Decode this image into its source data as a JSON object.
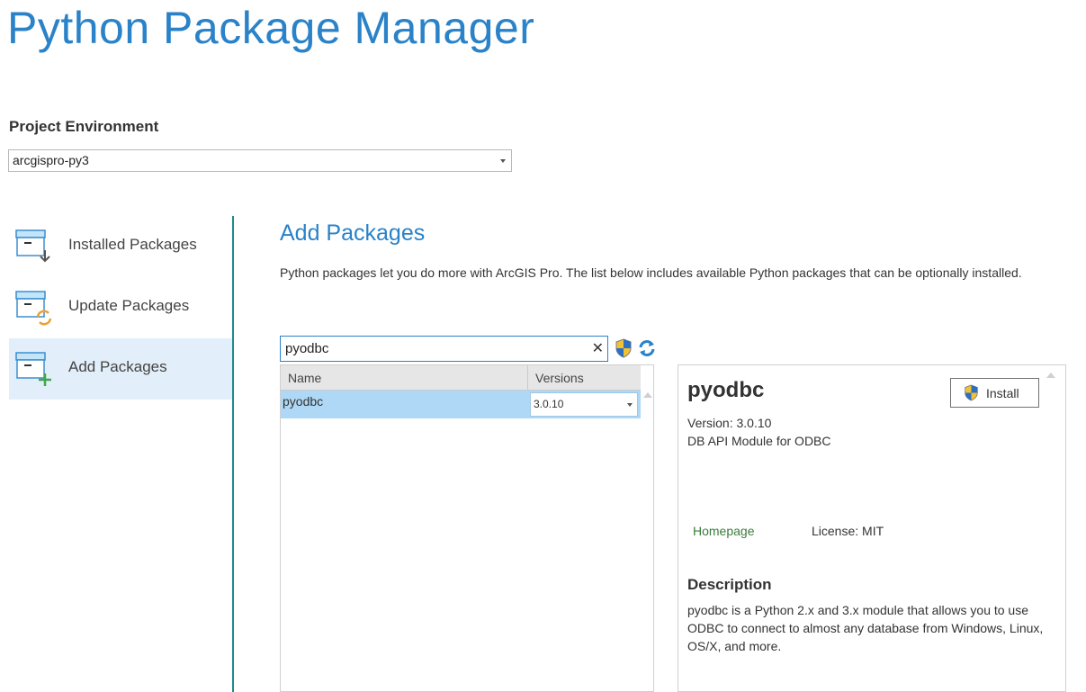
{
  "app": {
    "title": "Python Package Manager"
  },
  "environment": {
    "label": "Project Environment",
    "selected": "arcgispro-py3"
  },
  "sidebar": {
    "items": [
      {
        "label": "Installed Packages",
        "icon": "installed-packages-icon"
      },
      {
        "label": "Update Packages",
        "icon": "update-packages-icon"
      },
      {
        "label": "Add Packages",
        "icon": "add-packages-icon",
        "active": true
      }
    ]
  },
  "main": {
    "title": "Add Packages",
    "description": "Python packages let you do more with ArcGIS Pro. The list below includes available Python packages that can be optionally installed.",
    "search": {
      "value": "pyodbc",
      "clear_glyph": "✕"
    },
    "list": {
      "columns": [
        "Name",
        "Versions"
      ],
      "rows": [
        {
          "name": "pyodbc",
          "version": "3.0.10"
        }
      ]
    }
  },
  "details": {
    "name": "pyodbc",
    "install_label": "Install",
    "version_label": "Version:",
    "version": "3.0.10",
    "summary": "DB API Module for ODBC",
    "homepage_label": "Homepage",
    "license_label": "License:",
    "license": "MIT",
    "description_heading": "Description",
    "description": "pyodbc is a Python 2.x and 3.x module that allows you to use ODBC to connect to almost any database from Windows, Linux, OS/X, and more."
  },
  "colors": {
    "accent": "#2a82c8",
    "selection": "#aed8f5",
    "active_nav": "#e2eef9",
    "divider": "#1e8a8a",
    "link": "#3a7d3a"
  }
}
